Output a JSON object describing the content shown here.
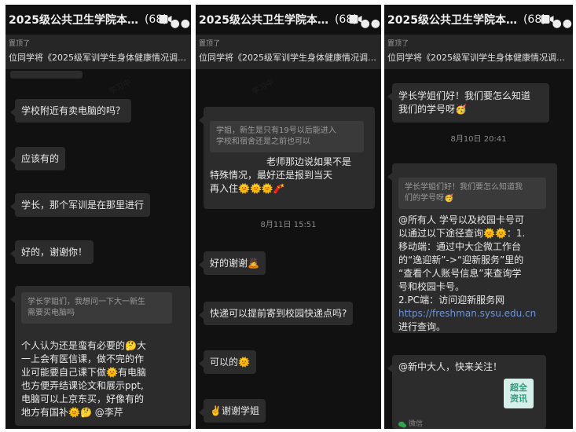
{
  "panels": [
    {
      "header": {
        "title": "2025级公共卫生学院本…",
        "count": "(68)"
      },
      "pinned": {
        "label": "置顶了",
        "text": "位同学将《2025级军训学生身体健康情况调…"
      },
      "messages": [
        "学校附近有卖电脑的吗？",
        "应该有的",
        "学长，那个军训是在那里进行",
        "好的，谢谢你！"
      ],
      "quote_reply": {
        "quote": [
          "学长学姐们，我想问一下大一新生",
          "需要买电脑吗"
        ],
        "lines": [
          "个人认为还是蛮有必要的🤔大",
          "一上会有医信课，做不完的作",
          "业可能要自己课下做🌞有电脑",
          "也方便弄结课论文和展示ppt,",
          "电脑可以上京东买，好像有的",
          "地方有国补🌞🤔 @李芹"
        ]
      }
    },
    {
      "header": {
        "title": "2025级公共卫生学院本…",
        "count": "(68)"
      },
      "pinned": {
        "label": "置顶了",
        "text": "位同学将《2025级军训学生身体健康情况调…"
      },
      "quote_reply": {
        "quote": [
          "学姐，新生是只有19号以后能进入",
          "学校和宿舍还是之前也可以"
        ],
        "lines": [
          "老师那边说如果不是",
          "特殊情况，最好还是报到当天",
          "再入住🌞🌞🌞🧨"
        ]
      },
      "timestamp": "8月11日 15:51",
      "messages": [
        "好的谢谢🙇",
        "快递可以提前寄到校园快递点吗?",
        "可以的🌞",
        "✌️谢谢学姐"
      ]
    },
    {
      "header": {
        "title": "2025级公共卫生学院本…",
        "count": "(68)"
      },
      "pinned": {
        "label": "置顶了",
        "text": "位同学将《2025级军训学生身体健康情况调…"
      },
      "question_lines": [
        "学长学姐们好！我们要怎么知道",
        "我们的学号呀🥳"
      ],
      "timestamp": "8月10日 20:41",
      "quote_reply": {
        "quote": [
          "学长学姐们好！我们要怎么知道我",
          "们的学号呀🥳"
        ],
        "lines": [
          "@所有人 学号以及校园卡号可",
          "以通过以下途径查询🌞🌞：1.",
          "移动端：通过中大企微工作台",
          "的“逸迎新”->“迎新服务”里的",
          "“查看个人账号信息”来查询学",
          "号和校园卡号。",
          "2.PC端：访问迎新服务网"
        ],
        "link": "https://freshman.sysu.edu.cn",
        "after_link": "进行查询。"
      },
      "share_card": {
        "text": "@新中大人，快来关注！",
        "logo_lines": [
          "超全",
          "资讯"
        ],
        "source": "微信"
      }
    }
  ],
  "colors": {
    "background": "#111111",
    "bubble": "#2c2c2c",
    "quote": "#3a3a3a",
    "link": "#6e95d8"
  },
  "icons": [
    "video-call-icon",
    "more-options-icon",
    "wechat-icon"
  ]
}
